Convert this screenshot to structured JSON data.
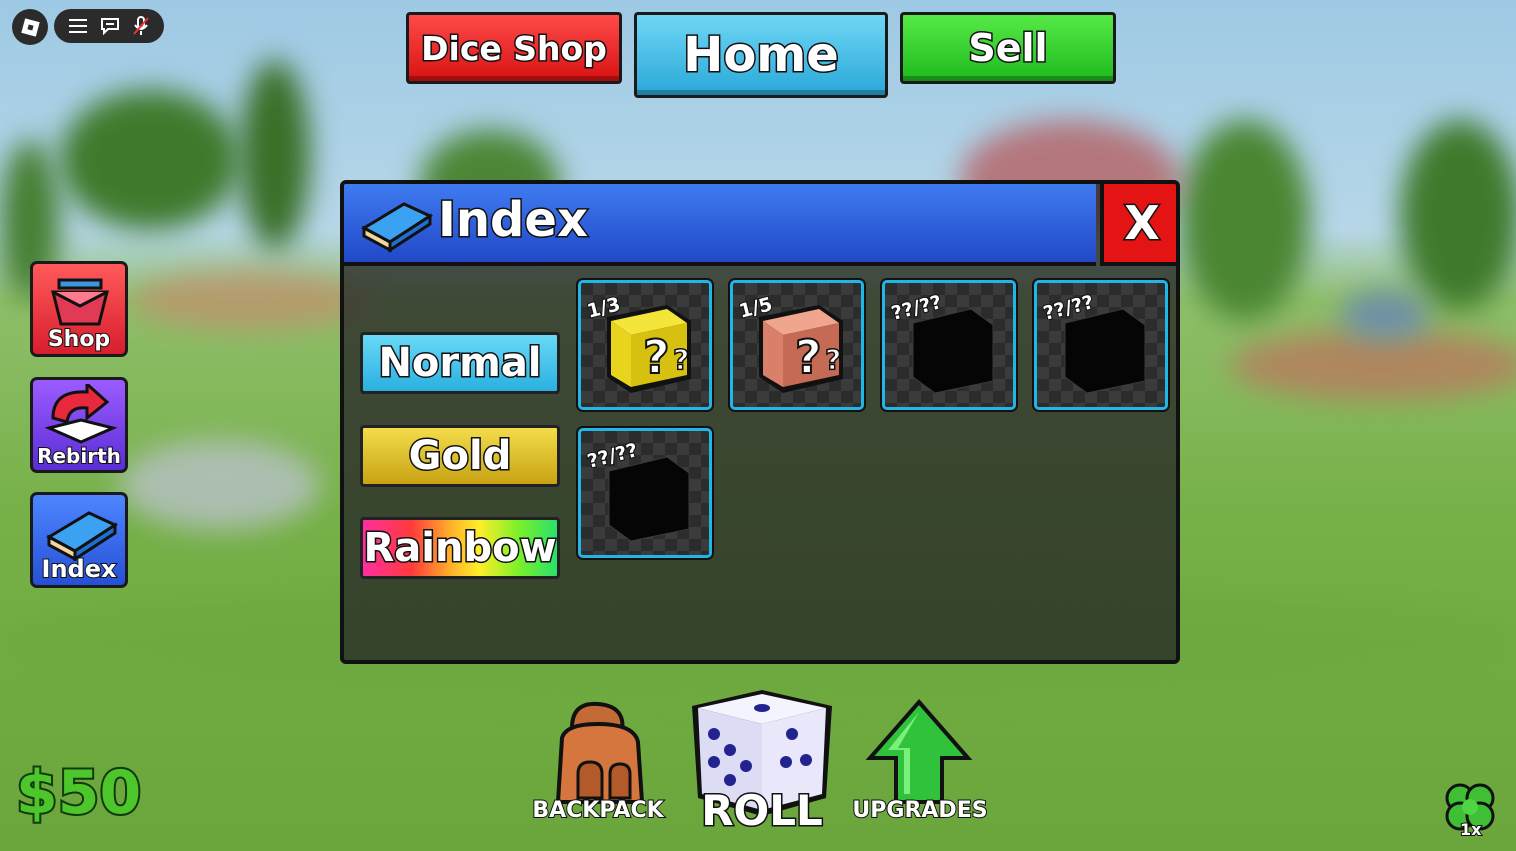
{
  "topbar": {
    "menu_icon": "hamburger-menu-icon",
    "chat_icon": "chat-icon",
    "mic_icon": "microphone-muted-icon",
    "dice_shop_label": "Dice Shop",
    "home_label": "Home",
    "sell_label": "Sell"
  },
  "sidebar": {
    "items": [
      {
        "label": "Shop",
        "icon": "shop-basket-icon"
      },
      {
        "label": "Rebirth",
        "icon": "rebirth-arrow-icon"
      },
      {
        "label": "Index",
        "icon": "book-icon"
      }
    ]
  },
  "index_panel": {
    "title": "Index",
    "close_label": "X",
    "categories": [
      "Normal",
      "Gold",
      "Rainbow"
    ],
    "tiles": [
      {
        "count": "1/3",
        "icon": "yellow-lucky-block-icon"
      },
      {
        "count": "1/5",
        "icon": "red-lucky-block-icon"
      },
      {
        "count": "??/??",
        "icon": "locked-block-icon"
      },
      {
        "count": "??/??",
        "icon": "locked-block-icon"
      },
      {
        "count": "??/??",
        "icon": "locked-block-icon"
      }
    ]
  },
  "bottom": {
    "money": "$50",
    "backpack_label": "BACKPACK",
    "roll_label": "ROLL",
    "upgrades_label": "UPGRADES",
    "luck_multiplier": "1x"
  },
  "colors": {
    "dice_shop": "#e81c1c",
    "home": "#3cc0ec",
    "sell": "#2fd62f",
    "panel_header": "#2f5fe0",
    "tile_border": "#23b5e6",
    "money": "#4cc62a"
  }
}
